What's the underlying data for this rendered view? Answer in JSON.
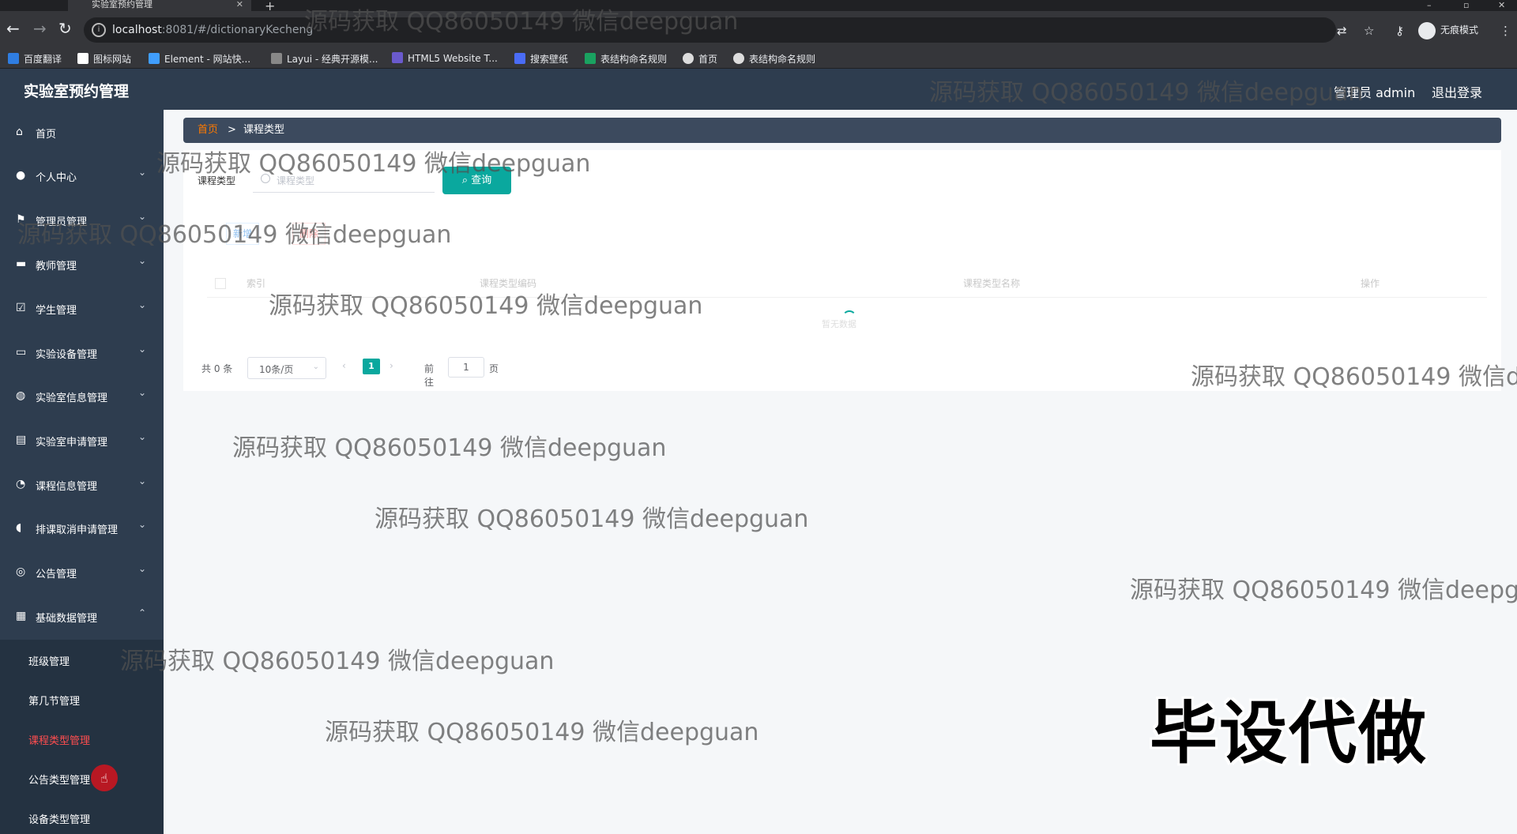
{
  "browser": {
    "tab_title": "实验室预约管理",
    "url_host": "localhost",
    "url_rest": ":8081/#/dictionaryKecheng",
    "profile_label": "无痕模式",
    "bookmarks": [
      "百度翻译",
      "图标网站",
      "Element - 网站快...",
      "Layui - 经典开源模...",
      "HTML5 Website T...",
      "搜索壁纸",
      "表结构命名规则",
      "首页",
      "表结构命名规则"
    ]
  },
  "header": {
    "title": "实验室预约管理",
    "user": "管理员 admin",
    "logout": "退出登录"
  },
  "sidebar": {
    "items": [
      {
        "label": "首页"
      },
      {
        "label": "个人中心"
      },
      {
        "label": "管理员管理"
      },
      {
        "label": "教师管理"
      },
      {
        "label": "学生管理"
      },
      {
        "label": "实验设备管理"
      },
      {
        "label": "实验室信息管理"
      },
      {
        "label": "实验室申请管理"
      },
      {
        "label": "课程信息管理"
      },
      {
        "label": "排课取消申请管理"
      },
      {
        "label": "公告管理"
      },
      {
        "label": "基础数据管理"
      }
    ],
    "subitems": [
      {
        "label": "班级管理"
      },
      {
        "label": "第几节管理"
      },
      {
        "label": "课程类型管理"
      },
      {
        "label": "公告类型管理"
      },
      {
        "label": "设备类型管理"
      }
    ]
  },
  "breadcrumb": {
    "home": "首页",
    "separator": ">",
    "current": "课程类型"
  },
  "search": {
    "label": "课程类型",
    "placeholder": "课程类型",
    "button": "查询"
  },
  "actions": {
    "add": "新增",
    "delete": "删除"
  },
  "table": {
    "columns": [
      "索引",
      "课程类型编码",
      "课程类型名称",
      "操作"
    ],
    "empty_text": "暂无数据"
  },
  "pagination": {
    "total": "共 0 条",
    "page_size": "10条/页",
    "current_page": "1",
    "goto_label": "前往",
    "goto_value": "1",
    "page_unit": "页"
  },
  "watermark": {
    "text": "源码获取 QQ86050149 微信deepguan",
    "stamp": "毕设代做"
  }
}
